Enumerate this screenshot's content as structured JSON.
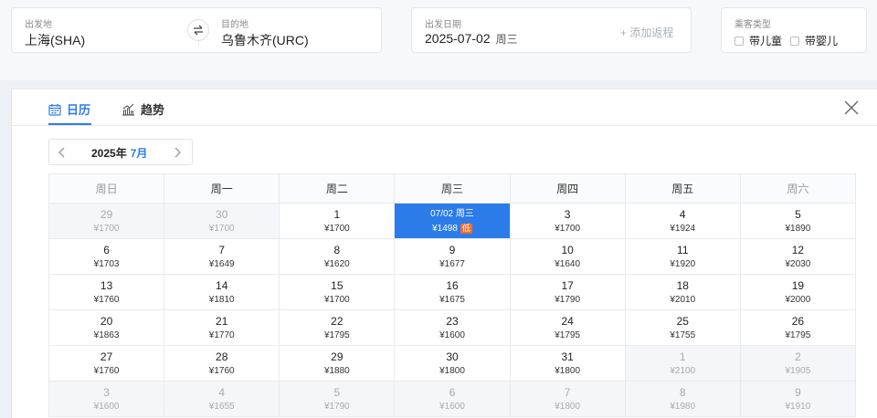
{
  "search": {
    "origin": {
      "label": "出发地",
      "value": "上海(SHA)"
    },
    "destination": {
      "label": "目的地",
      "value": "乌鲁木齐(URC)"
    },
    "date": {
      "label": "出发日期",
      "value": "2025-07-02",
      "weekday": "周三",
      "add_return": "+ 添加返程"
    },
    "passengers": {
      "label": "乘客类型",
      "options": [
        "带儿童",
        "带婴儿"
      ]
    }
  },
  "tabs": {
    "calendar": "日历",
    "trend": "趋势"
  },
  "month_nav": {
    "year": "2025年",
    "month": "7月"
  },
  "weekdays": [
    "周日",
    "周一",
    "周二",
    "周三",
    "周四",
    "周五",
    "周六"
  ],
  "low_badge": "低",
  "weeks": [
    [
      {
        "d": "29",
        "p": "¥1700",
        "other": true
      },
      {
        "d": "30",
        "p": "¥1700",
        "other": true
      },
      {
        "d": "1",
        "p": "¥1700"
      },
      {
        "d": "07/02 周三",
        "p": "¥1498",
        "selected": true,
        "low": true
      },
      {
        "d": "3",
        "p": "¥1700"
      },
      {
        "d": "4",
        "p": "¥1924"
      },
      {
        "d": "5",
        "p": "¥1890"
      }
    ],
    [
      {
        "d": "6",
        "p": "¥1703"
      },
      {
        "d": "7",
        "p": "¥1649"
      },
      {
        "d": "8",
        "p": "¥1620"
      },
      {
        "d": "9",
        "p": "¥1677"
      },
      {
        "d": "10",
        "p": "¥1640"
      },
      {
        "d": "11",
        "p": "¥1920"
      },
      {
        "d": "12",
        "p": "¥2030"
      }
    ],
    [
      {
        "d": "13",
        "p": "¥1760"
      },
      {
        "d": "14",
        "p": "¥1810"
      },
      {
        "d": "15",
        "p": "¥1700"
      },
      {
        "d": "16",
        "p": "¥1675"
      },
      {
        "d": "17",
        "p": "¥1790"
      },
      {
        "d": "18",
        "p": "¥2010"
      },
      {
        "d": "19",
        "p": "¥2000"
      }
    ],
    [
      {
        "d": "20",
        "p": "¥1863"
      },
      {
        "d": "21",
        "p": "¥1770"
      },
      {
        "d": "22",
        "p": "¥1795"
      },
      {
        "d": "23",
        "p": "¥1600"
      },
      {
        "d": "24",
        "p": "¥1795"
      },
      {
        "d": "25",
        "p": "¥1755"
      },
      {
        "d": "26",
        "p": "¥1795"
      }
    ],
    [
      {
        "d": "27",
        "p": "¥1760"
      },
      {
        "d": "28",
        "p": "¥1760"
      },
      {
        "d": "29",
        "p": "¥1880"
      },
      {
        "d": "30",
        "p": "¥1800"
      },
      {
        "d": "31",
        "p": "¥1800"
      },
      {
        "d": "1",
        "p": "¥2100",
        "other": true
      },
      {
        "d": "2",
        "p": "¥1905",
        "other": true
      }
    ],
    [
      {
        "d": "3",
        "p": "¥1600",
        "other": true
      },
      {
        "d": "4",
        "p": "¥1655",
        "other": true
      },
      {
        "d": "5",
        "p": "¥1790",
        "other": true
      },
      {
        "d": "6",
        "p": "¥1600",
        "other": true
      },
      {
        "d": "7",
        "p": "¥1800",
        "other": true
      },
      {
        "d": "8",
        "p": "¥1980",
        "other": true
      },
      {
        "d": "9",
        "p": "¥1910",
        "other": true
      }
    ]
  ]
}
